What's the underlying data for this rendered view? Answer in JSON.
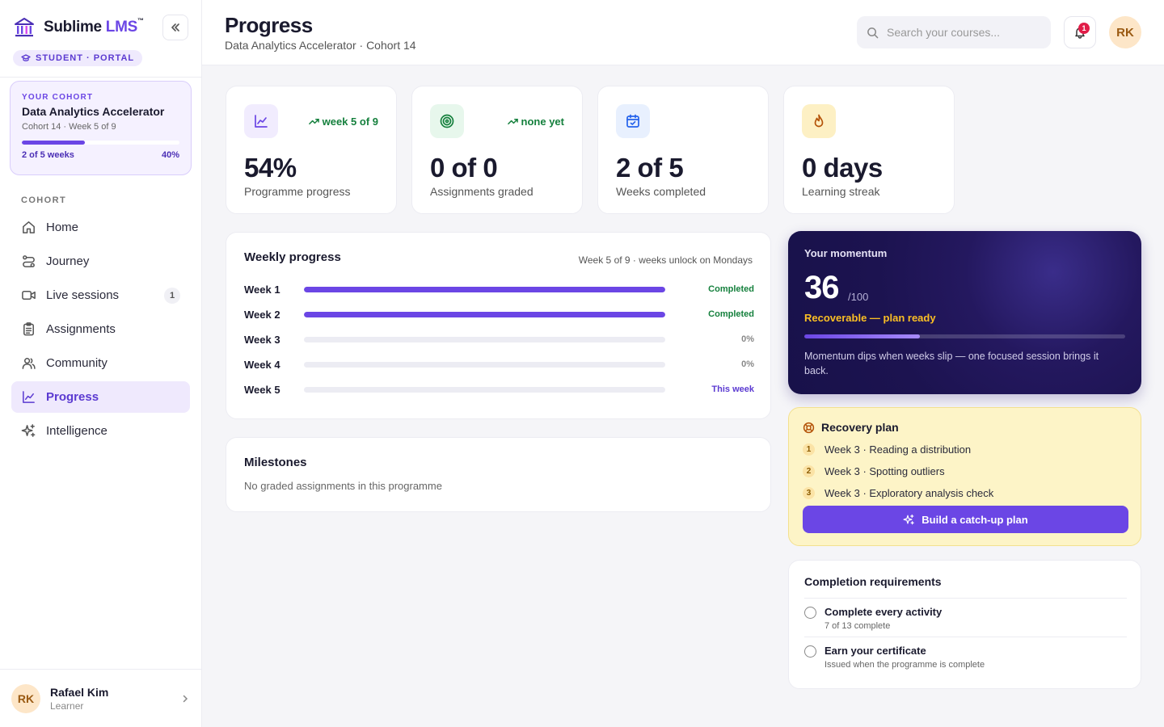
{
  "brand": {
    "name": "Sublime",
    "suffix": "LMS",
    "tm": "™",
    "portal": "STUDENT · PORTAL"
  },
  "cohort_card": {
    "label": "YOUR COHORT",
    "title": "Data Analytics Accelerator",
    "sub": "Cohort 14 · Week 5 of 9",
    "progress_label": "2 of 5 weeks",
    "progress_pct_label": "40%",
    "progress": 0.4
  },
  "nav": {
    "section": "COHORT",
    "items": [
      {
        "label": "Home",
        "icon": "home-icon"
      },
      {
        "label": "Journey",
        "icon": "route-icon"
      },
      {
        "label": "Live sessions",
        "icon": "video-icon",
        "count": "1"
      },
      {
        "label": "Assignments",
        "icon": "clipboard-icon"
      },
      {
        "label": "Community",
        "icon": "users-icon"
      },
      {
        "label": "Progress",
        "icon": "chart-icon",
        "active": true
      },
      {
        "label": "Intelligence",
        "icon": "sparkles-icon"
      }
    ]
  },
  "user": {
    "initials": "RK",
    "name": "Rafael Kim",
    "role": "Learner"
  },
  "header": {
    "title": "Progress",
    "subtitle": "Data Analytics Accelerator · Cohort 14",
    "search_placeholder": "Search your courses...",
    "notifications": "1",
    "initials": "RK"
  },
  "stats": [
    {
      "value": "54%",
      "label": "Programme progress",
      "trend": "week 5 of 9",
      "icon": "chart-icon",
      "color": "#6b46e5",
      "bg": "#f1ecfe"
    },
    {
      "value": "0 of 0",
      "label": "Assignments graded",
      "trend": "none yet",
      "icon": "target-icon",
      "color": "#15803d",
      "bg": "#e7f7ec"
    },
    {
      "value": "2 of 5",
      "label": "Weeks completed",
      "trend": "",
      "icon": "calendar-icon",
      "color": "#2563eb",
      "bg": "#e8f0fe"
    },
    {
      "value": "0 days",
      "label": "Learning streak",
      "trend": "",
      "icon": "flame-icon",
      "color": "#b45309",
      "bg": "#fdf0c4"
    }
  ],
  "weekly": {
    "title": "Weekly progress",
    "meta": "Week 5 of 9 · weeks unlock on Mondays",
    "weeks": [
      {
        "label": "Week 1",
        "progress": 1,
        "status": "Completed",
        "kind": "done"
      },
      {
        "label": "Week 2",
        "progress": 1,
        "status": "Completed",
        "kind": "done"
      },
      {
        "label": "Week 3",
        "progress": 0,
        "status": "0%",
        "kind": "zero"
      },
      {
        "label": "Week 4",
        "progress": 0,
        "status": "0%",
        "kind": "zero"
      },
      {
        "label": "Week 5",
        "progress": 0,
        "status": "This week",
        "kind": "cur"
      }
    ]
  },
  "milestones": {
    "title": "Milestones",
    "empty": "No graded assignments in this programme"
  },
  "momentum": {
    "title": "Your momentum",
    "score": "36",
    "out_of": "/100",
    "status": "Recoverable — plan ready",
    "progress": 0.36,
    "note": "Momentum dips when weeks slip — one focused session brings it back."
  },
  "recovery": {
    "title": "Recovery plan",
    "items": [
      {
        "num": "1",
        "label": "Week 3 · Reading a distribution"
      },
      {
        "num": "2",
        "label": "Week 3 · Spotting outliers"
      },
      {
        "num": "3",
        "label": "Week 3 · Exploratory analysis check"
      }
    ],
    "button": "Build a catch-up plan"
  },
  "completion": {
    "title": "Completion requirements",
    "items": [
      {
        "title": "Complete every activity",
        "sub": "7 of 13 complete"
      },
      {
        "title": "Earn your certificate",
        "sub": "Issued when the programme is complete"
      }
    ]
  }
}
